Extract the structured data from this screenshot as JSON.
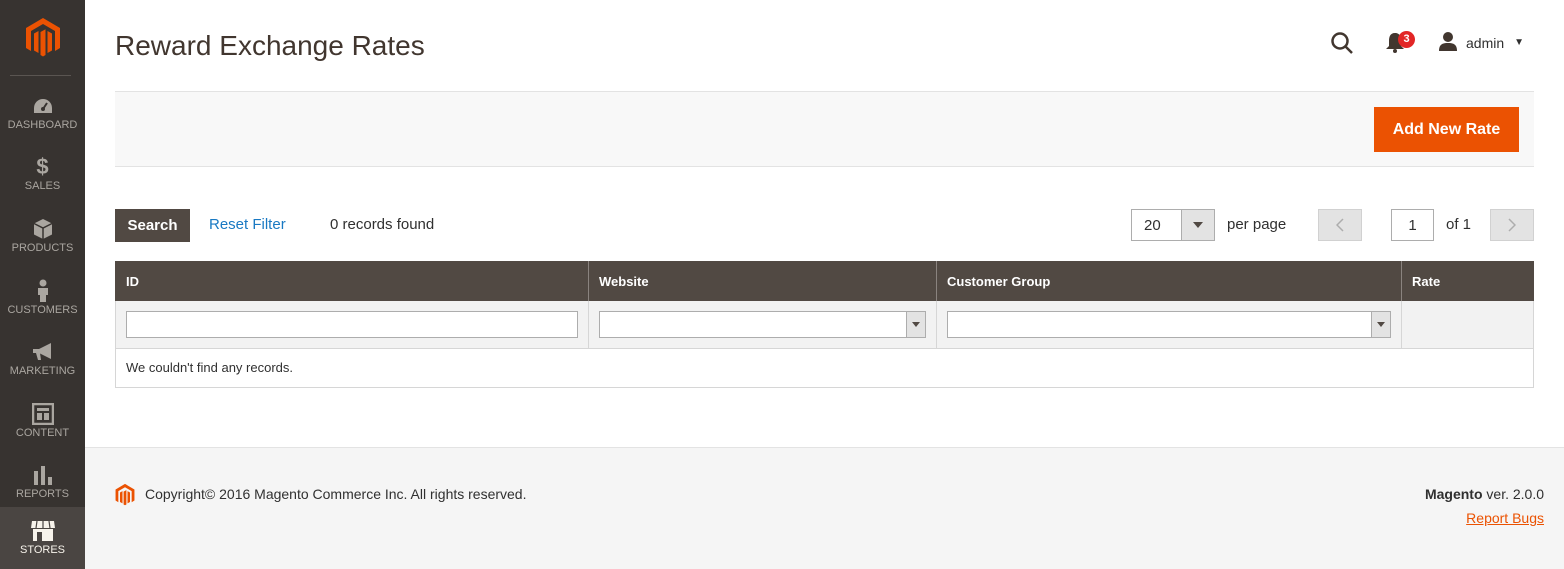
{
  "colors": {
    "sidebar_bg": "#373330",
    "accent_orange": "#eb5202",
    "header_dark": "#514943",
    "link_blue": "#1979c3",
    "badge_red": "#e22626"
  },
  "sidebar": {
    "logo_icon": "magento-logo-icon",
    "items": [
      {
        "label": "DASHBOARD",
        "icon": "dashboard-icon"
      },
      {
        "label": "SALES",
        "icon": "dollar-icon"
      },
      {
        "label": "PRODUCTS",
        "icon": "cube-icon"
      },
      {
        "label": "CUSTOMERS",
        "icon": "person-icon"
      },
      {
        "label": "MARKETING",
        "icon": "megaphone-icon"
      },
      {
        "label": "CONTENT",
        "icon": "layout-icon"
      },
      {
        "label": "REPORTS",
        "icon": "bar-chart-icon"
      },
      {
        "label": "STORES",
        "icon": "storefront-icon"
      }
    ],
    "active": "STORES"
  },
  "header": {
    "title": "Reward Exchange Rates",
    "notifications_count": "3",
    "user_name": "admin"
  },
  "actions": {
    "add_button": "Add New Rate"
  },
  "grid_controls": {
    "search_button": "Search",
    "reset_filter": "Reset Filter",
    "records_found": "0 records found",
    "per_page_value": "20",
    "per_page_label": "per page",
    "current_page": "1",
    "page_of": "of 1"
  },
  "table": {
    "columns": [
      "ID",
      "Website",
      "Customer Group",
      "Rate"
    ],
    "empty_message": "We couldn't find any records."
  },
  "footer": {
    "copyright": "Copyright© 2016 Magento Commerce Inc. All rights reserved.",
    "brand": "Magento",
    "version": " ver. 2.0.0",
    "report_bugs": "Report Bugs"
  }
}
